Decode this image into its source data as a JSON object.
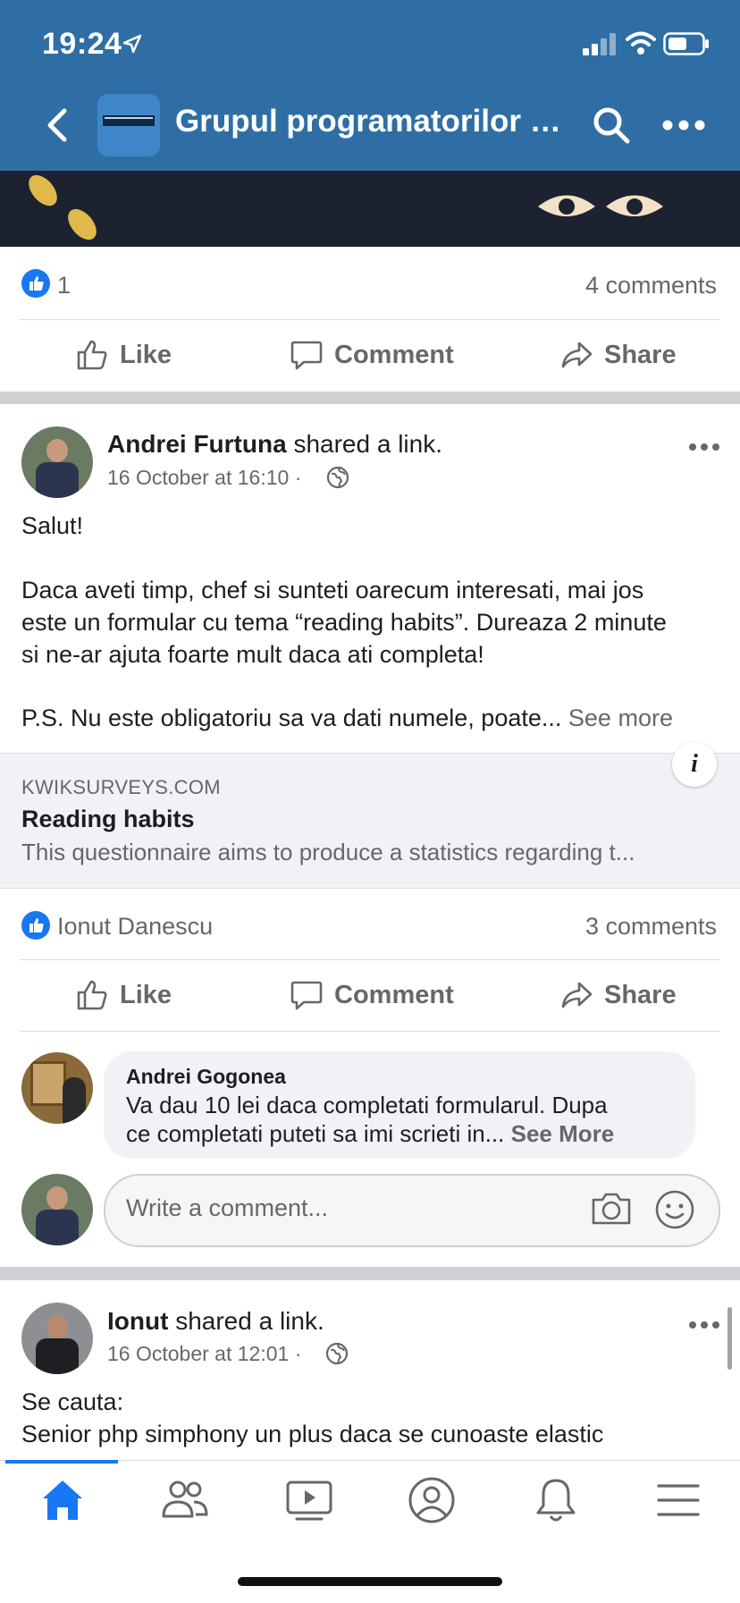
{
  "status_bar": {
    "time": "19:24"
  },
  "nav": {
    "title": "Grupul programatorilor - î..."
  },
  "post1_stats": {
    "likes": "1",
    "comments": "4 comments"
  },
  "actions": {
    "like": "Like",
    "comment": "Comment",
    "share": "Share"
  },
  "post2": {
    "author": "Andrei Furtuna",
    "verb": " shared a link.",
    "timestamp": "16 October at 16:10 ·",
    "lines": [
      "Salut!",
      "Daca aveti timp, chef si sunteti oarecum interesati, mai jos",
      "este un formular cu tema “reading habits”. Dureaza 2 minute",
      "si ne-ar ajuta foarte mult daca ati completa!",
      "P.S. Nu este obligatoriu sa va dati numele, poate..."
    ],
    "see_more": "See more",
    "link": {
      "domain": "KWIKSURVEYS.COM",
      "title": "Reading habits",
      "description": "This questionnaire aims to produce a statistics regarding t..."
    },
    "reactor": "Ionut Danescu",
    "comments": "3 comments",
    "comment": {
      "author": "Andrei Gogonea",
      "line1": "Va dau 10 lei daca completati formularul. Dupa",
      "line2": "ce completati puteti sa imi scrieti in...",
      "see_more": "See More"
    },
    "write_placeholder": "Write a comment..."
  },
  "post3": {
    "author": "Ionut",
    "verb": " shared a link.",
    "timestamp": "16 October at 12:01 ·",
    "line1": "Se cauta:",
    "line2": "Senior php simphony un plus daca se cunoaste elastic"
  },
  "colors": {
    "header": "#2f6ea5",
    "accent": "#1877f2",
    "text": "#1c1e21",
    "muted": "#65676b"
  },
  "icons": [
    "back-icon",
    "search-icon",
    "more-icon",
    "like-icon",
    "comment-icon",
    "share-icon",
    "globe-icon",
    "info-icon",
    "camera-icon",
    "emoji-icon",
    "home-icon",
    "friends-icon",
    "watch-icon",
    "profile-icon",
    "bell-icon",
    "menu-icon"
  ]
}
